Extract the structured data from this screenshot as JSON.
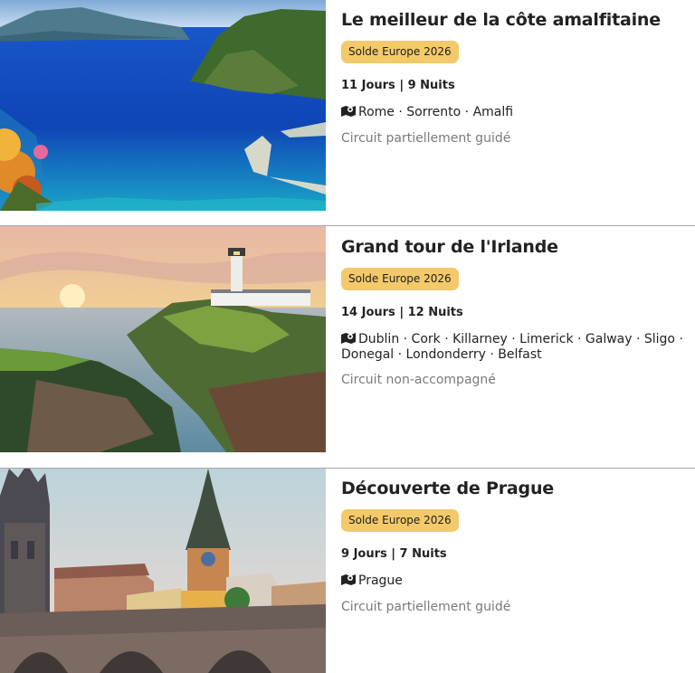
{
  "tours": [
    {
      "title": "Le meilleur de la côte amalfitaine",
      "badge": "Solde Europe 2026",
      "duration": "11 Jours | 9 Nuits",
      "route": "Rome · Sorrento · Amalfi",
      "guide": "Circuit partiellement guidé"
    },
    {
      "title": "Grand tour de l'Irlande",
      "badge": "Solde Europe 2026",
      "duration": "14 Jours | 12 Nuits",
      "route": "Dublin · Cork · Killarney · Limerick · Galway · Sligo · Donegal · Londonderry · Belfast",
      "guide": "Circuit non-accompagné"
    },
    {
      "title": "Découverte de Prague",
      "badge": "Solde Europe 2026",
      "duration": "9 Jours | 7 Nuits",
      "route": "Prague",
      "guide": "Circuit partiellement guidé"
    }
  ]
}
